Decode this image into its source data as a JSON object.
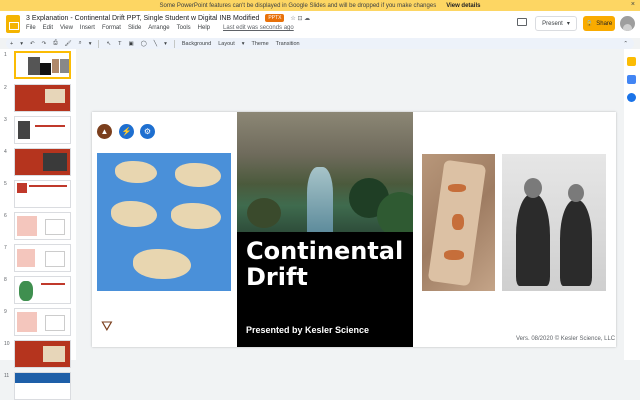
{
  "notice": {
    "text": "Some PowerPoint features can't be displayed in Google Slides and will be dropped if you make changes",
    "action": "View details",
    "close": "×"
  },
  "doc": {
    "title": "3 Explanation - Continental Drift PPT, Single Student w Digital INB Modified",
    "badge": "PPTX",
    "icons": "☆ ⊡ ☁"
  },
  "menus": [
    "File",
    "Edit",
    "View",
    "Insert",
    "Format",
    "Slide",
    "Arrange",
    "Tools",
    "Help"
  ],
  "last_edit": "Last edit was seconds ago",
  "header": {
    "present_label": "Present",
    "present_caret": "▾",
    "share_label": "Share",
    "lock_icon": "🔒"
  },
  "toolbar": {
    "plus": "+",
    "plus_caret": "▾",
    "undo": "↶",
    "redo": "↷",
    "print": "⎙",
    "paint": "🖌",
    "zoom": "⌕",
    "zoom_caret": "▾",
    "cursor": "↖",
    "textbox": "T",
    "image": "▣",
    "shape": "◯",
    "line": "╲",
    "line_caret": "▾",
    "background": "Background",
    "layout": "Layout",
    "layout_caret": "▾",
    "theme": "Theme",
    "transition": "Transition",
    "collapse": "⌃"
  },
  "slide_numbers": [
    "1",
    "2",
    "3",
    "4",
    "5",
    "6",
    "7",
    "8",
    "9",
    "10",
    "11"
  ],
  "slide": {
    "title": "Continental Drift",
    "presented_by": "Presented by Kesler Science",
    "version": "Vers. 08/2020  © Kesler Science, LLC",
    "icons": {
      "mountain": "▲",
      "bolt": "⚡",
      "gears": "⚙",
      "desk": "⛛"
    }
  }
}
